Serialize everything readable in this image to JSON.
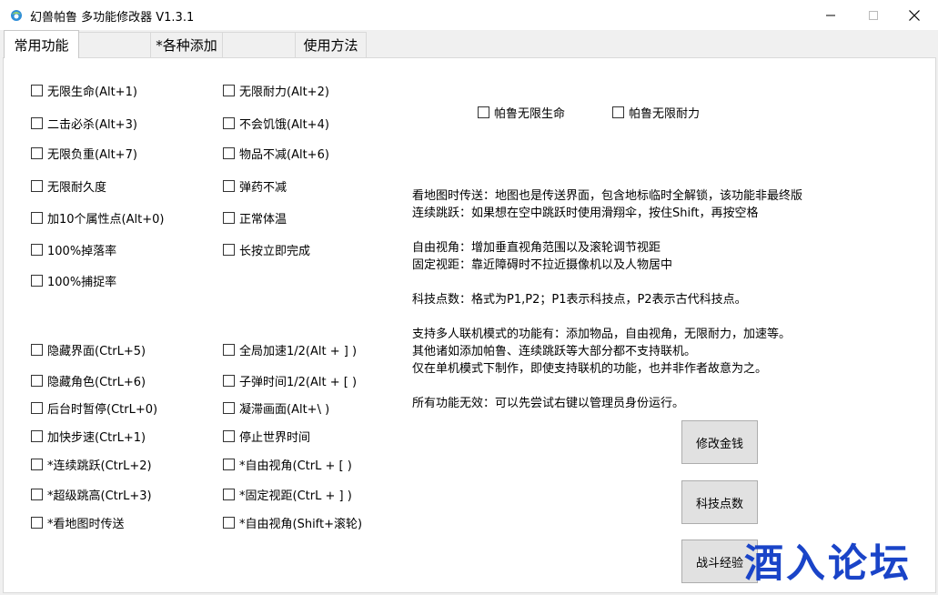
{
  "window": {
    "title": "幻兽帕鲁 多功能修改器  V1.3.1",
    "app_icon": "app-logo-icon",
    "controls": [
      "minimize-icon",
      "maximize-icon",
      "close-icon"
    ]
  },
  "tabs": [
    {
      "label": "常用功能",
      "active": true
    },
    {
      "label": "",
      "active": false
    },
    {
      "label": "*各种添加",
      "active": false
    },
    {
      "label": "",
      "active": false
    },
    {
      "label": "使用方法",
      "active": false
    }
  ],
  "checkboxes": {
    "col1": [
      {
        "label": "无限生命(Alt+1)",
        "checked": false
      },
      {
        "label": "二击必杀(Alt+3)",
        "checked": false
      },
      {
        "label": "无限负重(Alt+7)",
        "checked": false
      },
      {
        "label": "无限耐久度",
        "checked": false
      },
      {
        "label": "加10个属性点(Alt+0)",
        "checked": false
      },
      {
        "label": "100%掉落率",
        "checked": false
      },
      {
        "label": "100%捕捉率",
        "checked": false
      },
      {
        "label": "隐藏界面(CtrL+5)",
        "checked": false
      },
      {
        "label": "隐藏角色(CtrL+6)",
        "checked": false
      },
      {
        "label": "后台时暂停(CtrL+0)",
        "checked": false
      },
      {
        "label": "加快步速(CtrL+1)",
        "checked": false
      },
      {
        "label": "*连续跳跃(CtrL+2)",
        "checked": false
      },
      {
        "label": "*超级跳高(CtrL+3)",
        "checked": false
      },
      {
        "label": "*看地图时传送",
        "checked": false
      }
    ],
    "col2": [
      {
        "label": "无限耐力(Alt+2)",
        "checked": false
      },
      {
        "label": "不会饥饿(Alt+4)",
        "checked": false
      },
      {
        "label": "物品不减(Alt+6)",
        "checked": false
      },
      {
        "label": "弹药不减",
        "checked": false
      },
      {
        "label": "正常体温",
        "checked": false
      },
      {
        "label": "长按立即完成",
        "checked": false
      },
      {
        "label": "全局加速1/2(Alt + ] )",
        "checked": false
      },
      {
        "label": "子弹时间1/2(Alt + [ )",
        "checked": false
      },
      {
        "label": "凝滞画面(Alt+\\ )",
        "checked": false
      },
      {
        "label": "停止世界时间",
        "checked": false
      },
      {
        "label": "*自由视角(CtrL + [ )",
        "checked": false
      },
      {
        "label": "*固定视距(CtrL + ] )",
        "checked": false
      },
      {
        "label": "*自由视角(Shift+滚轮)",
        "checked": false
      }
    ],
    "pal": [
      {
        "label": "帕鲁无限生命",
        "checked": false
      },
      {
        "label": "帕鲁无限耐力",
        "checked": false
      }
    ]
  },
  "info_lines": [
    "看地图时传送：地图也是传送界面，包含地标临时全解锁，该功能非最终版",
    "连续跳跃：如果想在空中跳跃时使用滑翔伞，按住Shift，再按空格",
    "",
    "自由视角：增加垂直视角范围以及滚轮调节视距",
    "固定视距：靠近障碍时不拉近摄像机以及人物居中",
    "",
    "科技点数：格式为P1,P2；P1表示科技点，P2表示古代科技点。",
    "",
    "支持多人联机模式的功能有：添加物品，自由视角，无限耐力，加速等。",
    "其他诸如添加帕鲁、连续跳跃等大部分都不支持联机。",
    "仅在单机模式下制作，即使支持联机的功能，也并非作者故意为之。",
    "",
    "所有功能无效：可以先尝试右键以管理员身份运行。"
  ],
  "buttons": {
    "money": "修改金钱",
    "tech": "科技点数",
    "exp": "战斗经验"
  },
  "watermark": "酒入论坛",
  "colors": {
    "panel_bg": "#ffffff",
    "window_bg": "#f0f0f0",
    "button_bg": "#e1e1e1",
    "watermark": "#1a44c8"
  }
}
